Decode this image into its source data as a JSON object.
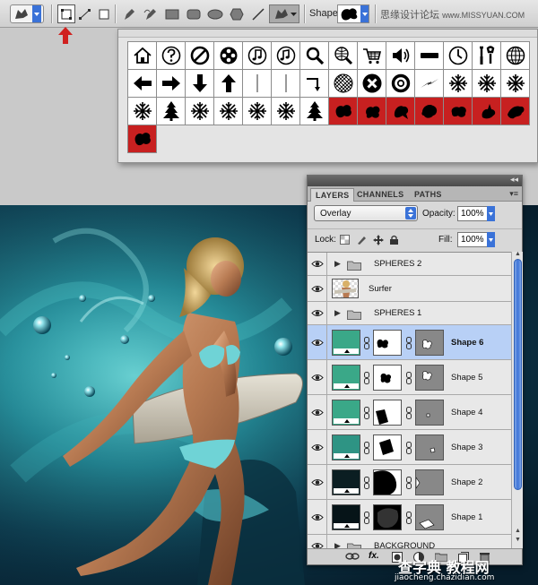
{
  "options_bar": {
    "shape_label": "Shape:",
    "brand_text": "思缘设计论坛",
    "brand_site": "www.MISSYUAN.COM"
  },
  "shape_panel": {
    "rows": [
      [
        "home-icon",
        "question-icon",
        "no-sign-icon",
        "film-reel-icon",
        "music-note-icon",
        "music-note-double-icon",
        "magnifier-icon",
        "globe-search-icon",
        "cart-icon",
        "speaker-icon",
        "rectangle-bar-icon",
        "clock-icon",
        "tools-icon",
        "globe-icon"
      ],
      [
        "arrow-left-icon",
        "arrow-right-icon",
        "arrow-down-icon",
        "arrow-up-icon",
        "thin-line-icon",
        "thin-line-icon",
        "bent-arrow-icon",
        "sphere-grid-icon",
        "x-circle-icon",
        "ring-icon",
        "lightning-icon",
        "snowflake-icon",
        "snowflake-icon",
        "snowflake-icon"
      ],
      [
        "snowflake-icon",
        "pine-tree-icon",
        "snowflake-icon",
        "snowflake-icon",
        "snowflake-icon",
        "snowflake-icon",
        "pine-tree-icon",
        "splat-icon",
        "splat-icon",
        "splat-icon",
        "splat-icon",
        "splat-icon",
        "splat-icon",
        "splat-icon"
      ],
      [
        "splat-icon"
      ]
    ],
    "selected_from": [
      2,
      7
    ]
  },
  "layers_panel": {
    "tabs": [
      "LAYERS",
      "CHANNELS",
      "PATHS"
    ],
    "blend_mode": "Overlay",
    "opacity_label": "Opacity:",
    "opacity_value": "100%",
    "lock_label": "Lock:",
    "fill_label": "Fill:",
    "fill_value": "100%",
    "layers": [
      {
        "name": "SPHERES 2",
        "type": "group"
      },
      {
        "name": "Surfer",
        "type": "image"
      },
      {
        "name": "SPHERES 1",
        "type": "group"
      },
      {
        "name": "Shape 6",
        "type": "shape",
        "color": "#3aa888",
        "selected": true
      },
      {
        "name": "Shape 5",
        "type": "shape",
        "color": "#3aa888"
      },
      {
        "name": "Shape 4",
        "type": "shape",
        "color": "#3aa888"
      },
      {
        "name": "Shape 3",
        "type": "shape",
        "color": "#2e9484"
      },
      {
        "name": "Shape 2",
        "type": "shape",
        "color": "#0b1e22"
      },
      {
        "name": "Shape 1",
        "type": "shape",
        "color": "#061418"
      },
      {
        "name": "BACKGROUND",
        "type": "group"
      }
    ]
  },
  "watermark": {
    "line1": "查字典 教程网",
    "line2": "jiaocheng.chazidian.com"
  },
  "colors": {
    "accent_blue": "#3a72d8",
    "selection_red": "#c72020",
    "selected_layer": "#b8d0f6"
  }
}
